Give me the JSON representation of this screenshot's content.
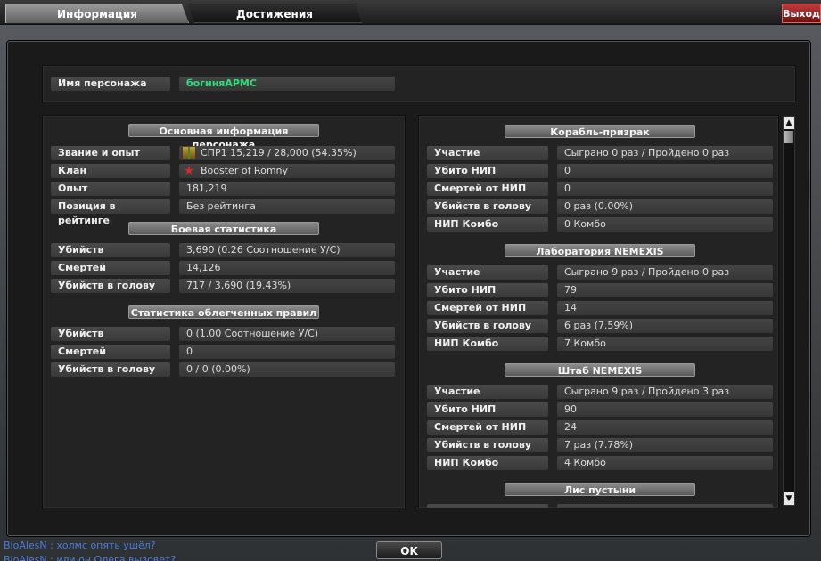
{
  "tabs": [
    {
      "label": "Информация"
    },
    {
      "label": "Достижения"
    }
  ],
  "exit_label": "Выход",
  "character": {
    "name_label": "Имя персонажа",
    "name_value": "богиняАРМС"
  },
  "basic": {
    "header": "Основная информация персонажа",
    "rows": [
      {
        "label": "Звание и опыт",
        "value": "СПР1  15,219 / 28,000 (54.35%)",
        "icon": "rank-icon"
      },
      {
        "label": "Клан",
        "value": "Booster of Romny",
        "icon": "clan-emblem-icon"
      },
      {
        "label": "Опыт",
        "value": "181,219"
      },
      {
        "label": "Позиция в рейтинге",
        "value": "Без рейтинга"
      }
    ]
  },
  "combat": {
    "header": "Боевая статистика",
    "rows": [
      {
        "label": "Убийств",
        "value": "3,690 (0.26 Соотношение У/С)"
      },
      {
        "label": "Смертей",
        "value": "14,126"
      },
      {
        "label": "Убийств в голову",
        "value": "717 / 3,690 (19.43%)"
      }
    ]
  },
  "light_rules": {
    "header": "Статистика облегченных правил",
    "rows": [
      {
        "label": "Убийств",
        "value": "0 (1.00 Соотношение У/С)"
      },
      {
        "label": "Смертей",
        "value": "0"
      },
      {
        "label": "Убийств в голову",
        "value": "0 / 0 (0.00%)"
      }
    ]
  },
  "modes": [
    {
      "header": "Корабль-призрак",
      "rows": [
        {
          "label": "Участие",
          "value": "Сыграно 0 раз / Пройдено 0 раз"
        },
        {
          "label": "Убито НИП",
          "value": "0"
        },
        {
          "label": "Смертей от НИП",
          "value": "0"
        },
        {
          "label": "Убийств в голову",
          "value": "0 раз (0.00%)"
        },
        {
          "label": "НИП Комбо",
          "value": "0 Комбо"
        }
      ]
    },
    {
      "header": "Лаборатория NEMEXIS",
      "rows": [
        {
          "label": "Участие",
          "value": "Сыграно 9 раз / Пройдено 0 раз"
        },
        {
          "label": "Убито НИП",
          "value": "79"
        },
        {
          "label": "Смертей от НИП",
          "value": "14"
        },
        {
          "label": "Убийств в голову",
          "value": "6 раз (7.59%)"
        },
        {
          "label": "НИП Комбо",
          "value": "7 Комбо"
        }
      ]
    },
    {
      "header": "Штаб NEMEXIS",
      "rows": [
        {
          "label": "Участие",
          "value": "Сыграно 9 раз / Пройдено 3 раз"
        },
        {
          "label": "Убито НИП",
          "value": "90"
        },
        {
          "label": "Смертей от НИП",
          "value": "24"
        },
        {
          "label": "Убийств в голову",
          "value": "7 раз (7.78%)"
        },
        {
          "label": "НИП Комбо",
          "value": "4 Комбо"
        }
      ]
    },
    {
      "header": "Лис пустыни",
      "rows": []
    }
  ],
  "ok_label": "OK",
  "chat": {
    "line1": "BioAlesN : холмс опять ушёл?",
    "line2": "BioAlesN : или он Олега вызовет?"
  }
}
